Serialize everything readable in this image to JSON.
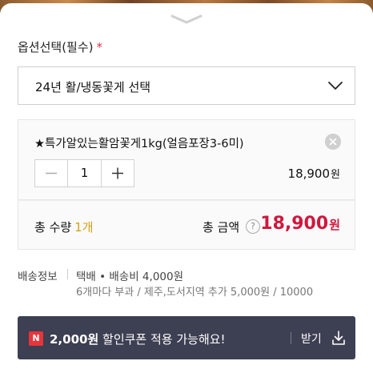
{
  "option": {
    "title": "옵션선택(필수)",
    "required_mark": "*",
    "select_value": "24년 활/냉동꽃게 선택"
  },
  "selected_item": {
    "name": "★특가알있는활암꽃게1kg(얼음포장3-6미)",
    "quantity": "1",
    "price": "18,900",
    "price_unit": "원"
  },
  "total": {
    "qty_label": "총 수량",
    "qty_value": "1개",
    "amount_label": "총 금액",
    "help_symbol": "?",
    "amount": "18,900",
    "amount_unit": "원"
  },
  "shipping": {
    "label": "배송정보",
    "line1": "택배 • 배송비 4,000원",
    "line2": "6개마다 부과 / 제주,도서지역 추가 5,000원 / 10000"
  },
  "coupon": {
    "badge": "N",
    "amount": "2,000원",
    "message": " 할인쿠폰 적용 가능해요!",
    "download_label": "받기"
  },
  "colors": {
    "accent_red": "#d0173d",
    "qty_yellow": "#d4a017",
    "coupon_bg": "#3d3f52",
    "badge_red": "#e8343a"
  },
  "icons": {
    "handle": "chevron-down-icon",
    "select": "chevron-down-icon",
    "remove": "close-circle-icon",
    "minus": "minus-icon",
    "plus": "plus-icon",
    "download": "download-icon"
  }
}
